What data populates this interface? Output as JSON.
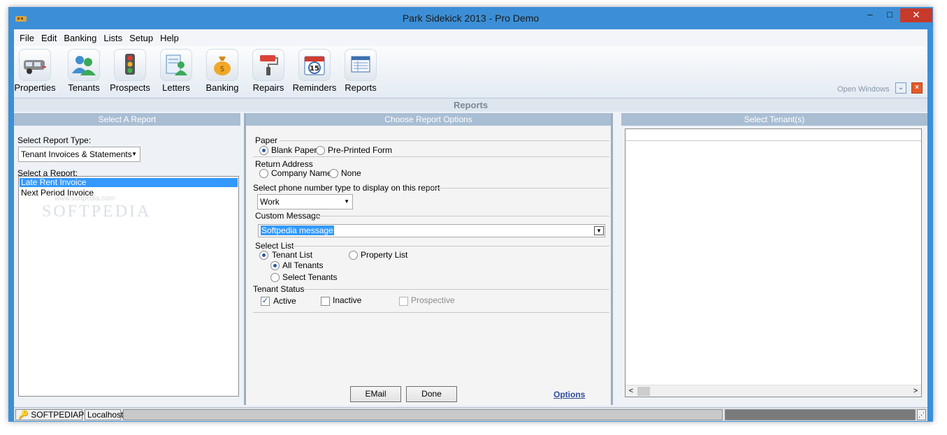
{
  "window": {
    "title": "Park Sidekick 2013 - Pro Demo",
    "min_glyph": "–",
    "max_glyph": "□",
    "close_glyph": "✕"
  },
  "menu": [
    "File",
    "Edit",
    "Banking",
    "Lists",
    "Setup",
    "Help"
  ],
  "toolbar": [
    {
      "label": "Properties",
      "icon": "trailer-icon"
    },
    {
      "label": "Tenants",
      "icon": "tenants-icon"
    },
    {
      "label": "Prospects",
      "icon": "traffic-light-icon"
    },
    {
      "label": "Letters",
      "icon": "letter-icon"
    },
    {
      "label": "Banking",
      "icon": "money-bag-icon"
    },
    {
      "label": "Repairs",
      "icon": "paint-roller-icon"
    },
    {
      "label": "Reminders",
      "icon": "calendar-icon"
    },
    {
      "label": "Reports",
      "icon": "report-icon"
    }
  ],
  "reminders_day": "15",
  "open_windows_label": "Open Windows",
  "section_title": "Reports",
  "left_panel": {
    "header": "Select A Report",
    "report_type_label": "Select Report Type:",
    "report_type_value": "Tenant Invoices & Statements",
    "report_label": "Select a Report:",
    "reports": [
      {
        "label": "Late Rent Invoice",
        "selected": true
      },
      {
        "label": "Next Period Invoice",
        "selected": false
      }
    ]
  },
  "middle_panel": {
    "header": "Choose Report Options",
    "paper_label": "Paper",
    "paper_options": [
      "Blank Paper",
      "Pre-Printed Form"
    ],
    "return_label": "Return Address",
    "return_options": [
      "Company Name",
      "None"
    ],
    "phone_label": "Select phone number type to display on this report",
    "phone_value": "Work",
    "message_label": "Custom Message",
    "message_value": "Softpedia message",
    "list_label": "Select List",
    "list_options": [
      "Tenant List",
      "Property List"
    ],
    "tenant_sub_options": [
      "All Tenants",
      "Select Tenants"
    ],
    "status_label": "Tenant Status",
    "status_options": [
      "Active",
      "Inactive",
      "Prospective"
    ],
    "email_button": "EMail",
    "done_button": "Done",
    "options_link": "Options"
  },
  "right_panel": {
    "header": "Select Tenant(s)"
  },
  "statusbar": {
    "computer": "SOFTPEDIAPC",
    "server": "Localhost"
  },
  "watermark": {
    "brand": "SOFTPEDIA",
    "url": "www.softpedia.com"
  },
  "colors": {
    "window_frame": "#3c8fd6",
    "panel_header": "#a9bed3",
    "selection": "#3399ff",
    "close_button": "#c7392a"
  }
}
